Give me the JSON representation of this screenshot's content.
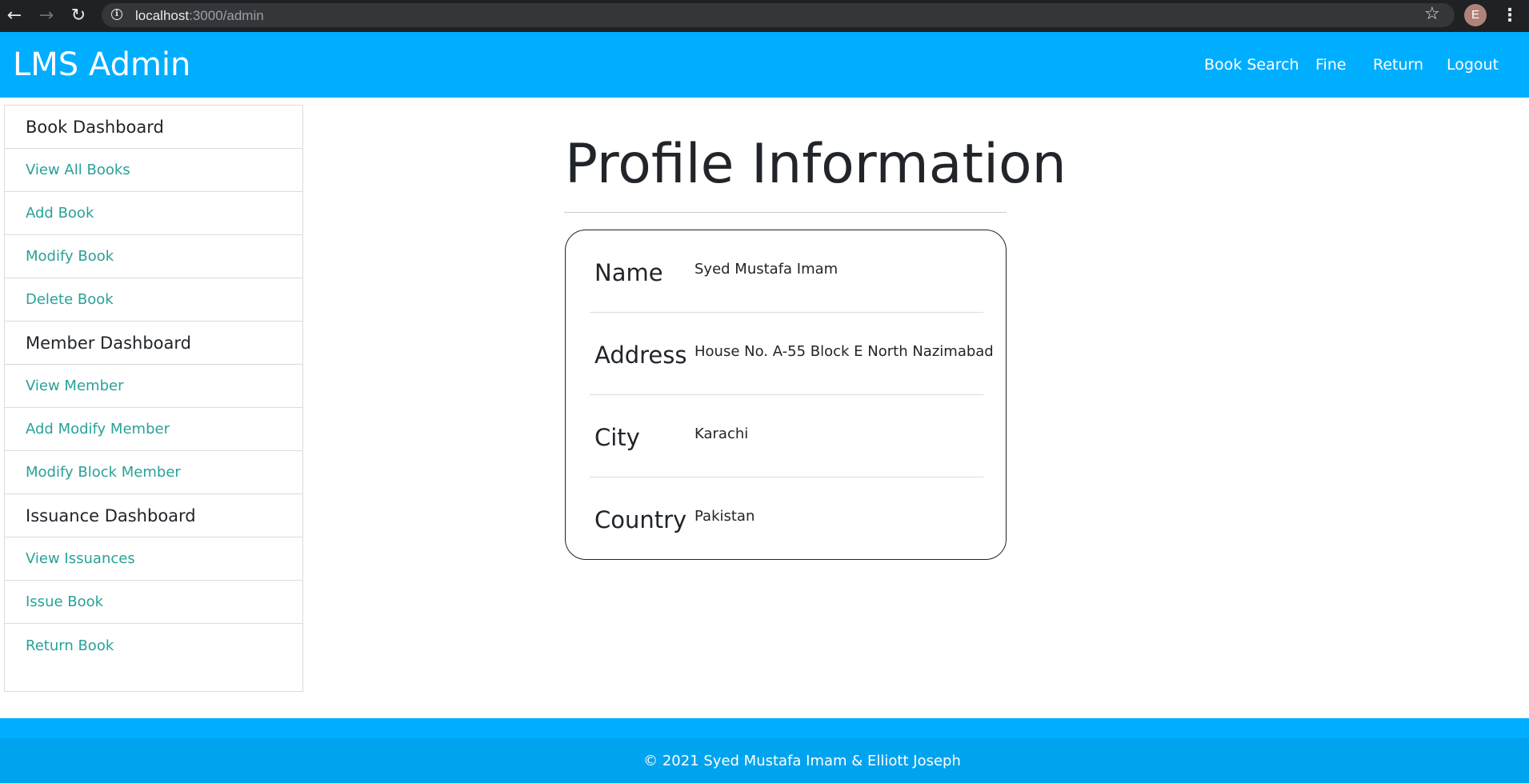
{
  "browser": {
    "back_icon": "←",
    "forward_icon": "→",
    "reload_icon": "↻",
    "info_icon": "i",
    "url_host": "localhost",
    "url_rest": ":3000/admin",
    "star_icon": "☆",
    "avatar_letter": "E",
    "menu_icon": "⋮"
  },
  "navbar": {
    "brand": "LMS Admin",
    "links": [
      "Book Search",
      "Fine",
      "Return",
      "Logout"
    ],
    "color": "#00aeff"
  },
  "sidebar": {
    "items": [
      {
        "label": "Book Dashboard",
        "header": true
      },
      {
        "label": "View All Books",
        "header": false
      },
      {
        "label": "Add Book",
        "header": false
      },
      {
        "label": "Modify Book",
        "header": false
      },
      {
        "label": "Delete Book",
        "header": false
      },
      {
        "label": "Member Dashboard",
        "header": true
      },
      {
        "label": "View Member",
        "header": false
      },
      {
        "label": "Add Modify Member",
        "header": false
      },
      {
        "label": "Modify Block Member",
        "header": false
      },
      {
        "label": "Issuance Dashboard",
        "header": true
      },
      {
        "label": "View Issuances",
        "header": false
      },
      {
        "label": "Issue Book",
        "header": false
      },
      {
        "label": "Return Book",
        "header": false
      }
    ],
    "link_color": "#2aa198"
  },
  "main": {
    "title": "Profile Information",
    "profile": [
      {
        "label": "Name",
        "value": "Syed Mustafa Imam"
      },
      {
        "label": "Address",
        "value": "House No. A-55 Block E North Nazimabad"
      },
      {
        "label": "City",
        "value": "Karachi"
      },
      {
        "label": "Country",
        "value": "Pakistan"
      }
    ]
  },
  "footer": {
    "text": "© 2021 Syed Mustafa Imam & Elliott Joseph"
  }
}
